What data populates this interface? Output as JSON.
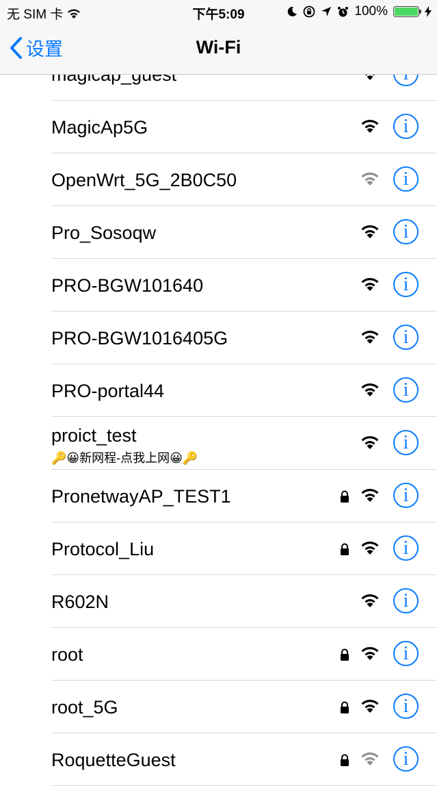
{
  "status_bar": {
    "carrier": "无 SIM 卡",
    "time": "下午5:09",
    "battery_text": "100%",
    "battery_level": 1.0
  },
  "nav": {
    "back_label": "设置",
    "title": "Wi-Fi"
  },
  "networks": [
    {
      "name": "magicap_guest",
      "sub": "",
      "locked": false,
      "signal": "strong"
    },
    {
      "name": "MagicAp5G",
      "sub": "",
      "locked": false,
      "signal": "strong"
    },
    {
      "name": "OpenWrt_5G_2B0C50",
      "sub": "",
      "locked": false,
      "signal": "weak"
    },
    {
      "name": "Pro_Sosoqw",
      "sub": "",
      "locked": false,
      "signal": "strong"
    },
    {
      "name": "PRO-BGW101640",
      "sub": "",
      "locked": false,
      "signal": "strong"
    },
    {
      "name": "PRO-BGW1016405G",
      "sub": "",
      "locked": false,
      "signal": "strong"
    },
    {
      "name": "PRO-portal44",
      "sub": "",
      "locked": false,
      "signal": "strong"
    },
    {
      "name": "proict_test",
      "sub": "🔑😀新网程-点我上网😀🔑",
      "locked": false,
      "signal": "strong"
    },
    {
      "name": "PronetwayAP_TEST1",
      "sub": "",
      "locked": true,
      "signal": "strong"
    },
    {
      "name": "Protocol_Liu",
      "sub": "",
      "locked": true,
      "signal": "strong"
    },
    {
      "name": "R602N",
      "sub": "",
      "locked": false,
      "signal": "strong"
    },
    {
      "name": "root",
      "sub": "",
      "locked": true,
      "signal": "strong"
    },
    {
      "name": "root_5G",
      "sub": "",
      "locked": true,
      "signal": "strong"
    },
    {
      "name": "RoquetteGuest",
      "sub": "",
      "locked": true,
      "signal": "weak"
    }
  ],
  "info_glyph": "i",
  "colors": {
    "accent": "#0a7aff",
    "battery": "#4cd964"
  }
}
